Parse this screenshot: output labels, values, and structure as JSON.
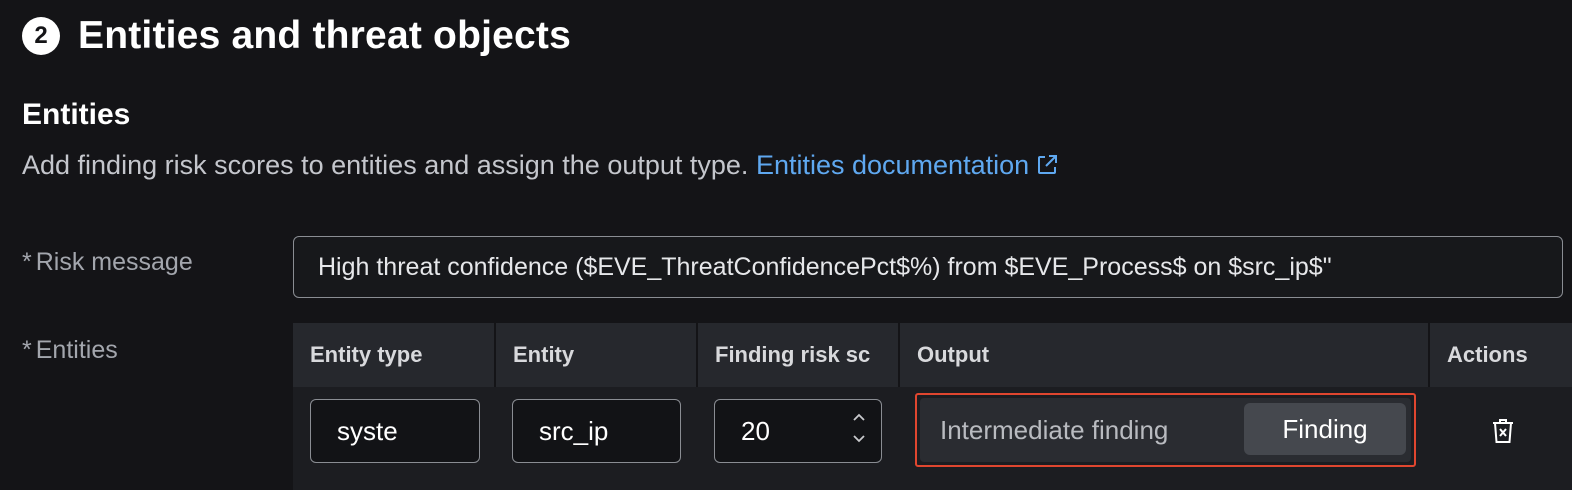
{
  "section": {
    "step_number": "2",
    "title": "Entities and threat objects"
  },
  "entities": {
    "title": "Entities",
    "description": "Add finding risk scores to entities and assign the output type.",
    "doc_link_label": "Entities documentation",
    "doc_link_icon": "external-link-icon"
  },
  "risk_message": {
    "required_mark": "*",
    "label": "Risk message",
    "value": "High threat confidence ($EVE_ThreatConfidencePct$%) from $EVE_Process$ on $src_ip$\""
  },
  "entities_table": {
    "required_mark": "*",
    "label": "Entities",
    "columns": [
      "Entity type",
      "Entity",
      "Finding risk sc",
      "Output",
      "Actions"
    ],
    "rows": [
      {
        "entity_type": "syste",
        "entity": "src_ip",
        "finding_risk_score": "20",
        "output_options": [
          "Intermediate finding",
          "Finding"
        ],
        "output_selected": "Finding",
        "action_icon": "trash-icon"
      }
    ]
  },
  "colors": {
    "background": "#141417",
    "link": "#5fa8f0",
    "highlight_border": "#e0462f"
  }
}
